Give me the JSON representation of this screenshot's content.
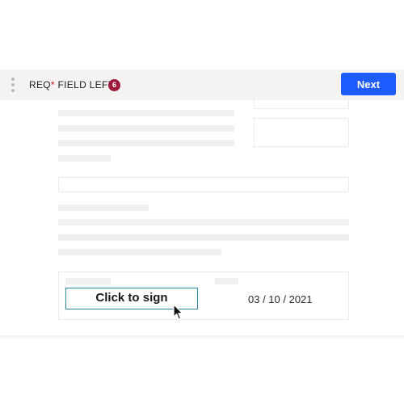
{
  "toolbar": {
    "required_prefix": "REQ",
    "required_asterisk": "*",
    "required_suffix": " FIELD LEFT",
    "remaining_count": "6",
    "next_label": "Next",
    "menu_icon": "kebab-vertical-icon"
  },
  "signature_block": {
    "sign_label": "Click to sign",
    "date_value": "03 / 10 / 2021"
  },
  "colors": {
    "accent": "#1f5cff",
    "badge": "#9b1a3a",
    "sign_border": "#2d86a6",
    "asterisk": "#c8102e"
  }
}
